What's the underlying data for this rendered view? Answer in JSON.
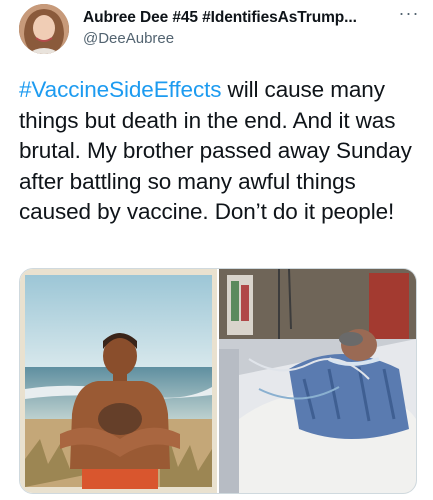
{
  "tweet": {
    "author": {
      "display_name": "Aubree Dee #45 #IdentifiesAsTrump...",
      "handle": "@DeeAubree",
      "avatar_icon": "user-avatar"
    },
    "more_icon": "more-options-icon",
    "hashtag": "#VaccineSideEffects",
    "body": " will cause many things but death in the end. And it was brutal. My brother passed away Sunday after battling so many awful things caused by vaccine.  Don’t do it people!",
    "media": [
      {
        "kind": "photo",
        "description_icon": "beach-photo"
      },
      {
        "kind": "photo",
        "description_icon": "hospital-photo"
      }
    ]
  },
  "colors": {
    "link": "#1d9bf0",
    "secondary_text": "#536471",
    "border": "#cfd9de"
  }
}
